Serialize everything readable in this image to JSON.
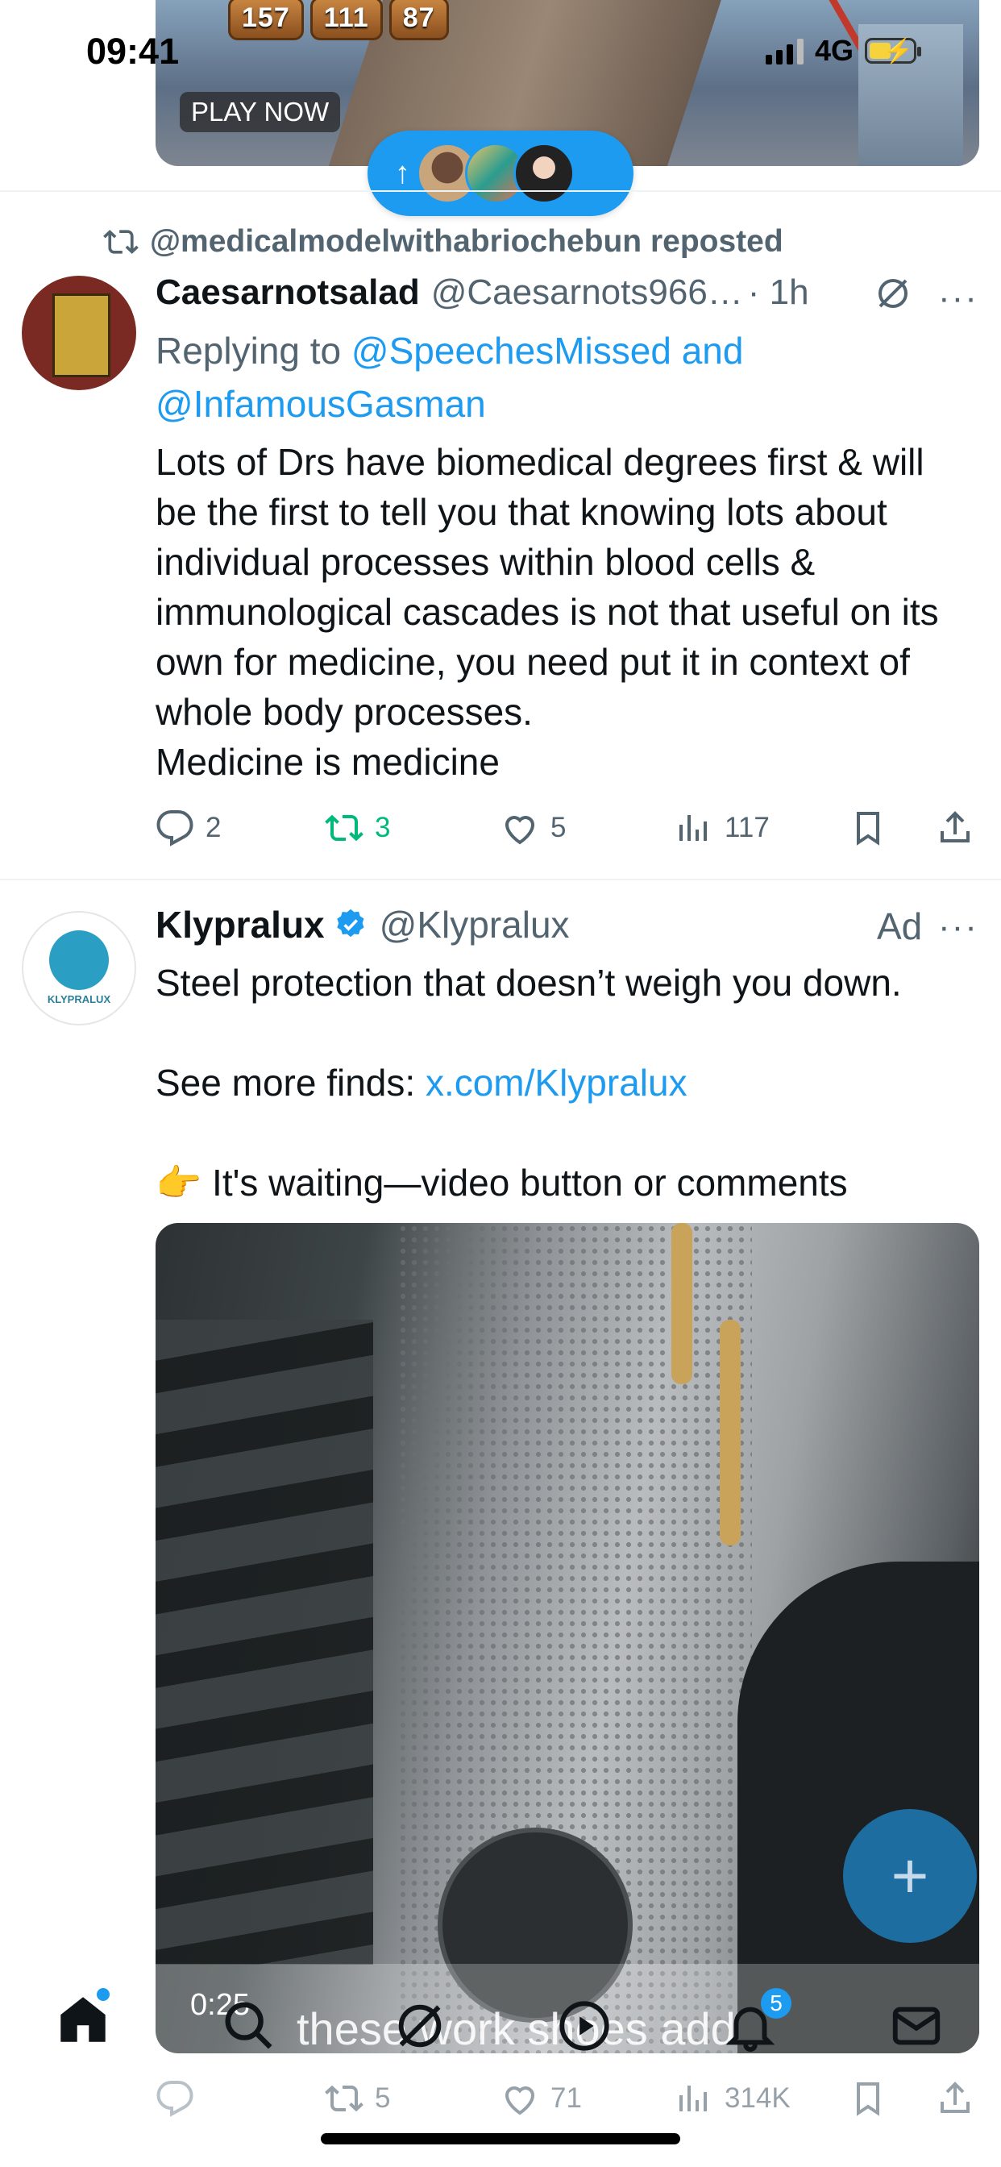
{
  "status_bar": {
    "time": "09:41",
    "network": "4G"
  },
  "top_media": {
    "scores": [
      "157",
      "111",
      "87"
    ],
    "cta": "PLAY NOW"
  },
  "tweet1": {
    "reposted_by": "@medicalmodelwithabriochebun reposted",
    "display_name": "Caesarnotsalad",
    "handle": "@Caesarnots966…",
    "time": "· 1h",
    "replying_prefix": "Replying to",
    "replying_users": "@SpeechesMissed and @InfamousGasman",
    "body": "Lots of Drs have biomedical degrees first & will be the first to tell you that knowing lots about individual processes within blood cells & immunological cascades is not that useful on its own for medicine, you need put it in context of whole body processes.\nMedicine is medicine",
    "replies": "2",
    "reposts": "3",
    "likes": "5",
    "views": "117"
  },
  "tweet2": {
    "display_name": "Klypralux",
    "handle": "@Klypralux",
    "ad_label": "Ad",
    "avatar_text": "KLYPRALUX",
    "line1": "Steel protection that doesn’t weigh you down.",
    "see_more_prefix": "See more finds: ",
    "see_more_link": "x.com/Klypralux",
    "cta_emoji": "👉",
    "cta_text": " It's waiting—video button or comments",
    "video_time": "0:25",
    "video_caption": "these work shoes add",
    "replies": "",
    "reposts": "5",
    "likes": "71",
    "views": "314K"
  },
  "tabbar": {
    "notifications_count": "5"
  },
  "colors": {
    "accent": "#1d9bf0",
    "repost_green": "#00ba7c",
    "muted": "#536471"
  },
  "icons": [
    "home-icon",
    "search-icon",
    "grok-icon",
    "play-icon",
    "bell-icon",
    "mail-icon",
    "compose-icon"
  ]
}
